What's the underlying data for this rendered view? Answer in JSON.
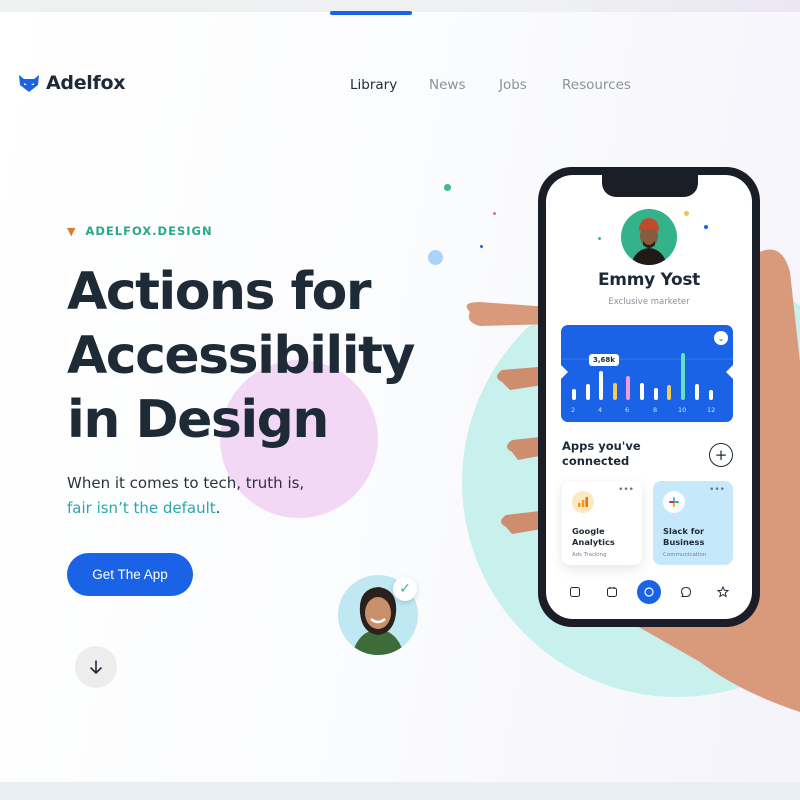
{
  "brand": {
    "name": "Adelfox"
  },
  "nav": {
    "items": [
      "Library",
      "News",
      "Jobs",
      "Resources"
    ],
    "active": "Library"
  },
  "hero": {
    "kicker": "ADELFOX.DESIGN",
    "headline": [
      "Actions for",
      "Accessibility",
      "in Design"
    ],
    "sub_line1": "When it comes to tech, truth is,",
    "sub_accent": "fair isn’t the default",
    "sub_end": ".",
    "cta_label": "Get The App"
  },
  "phone": {
    "profile": {
      "name": "Emmy Yost",
      "role": "Exclusive marketer"
    },
    "chart": {
      "tooltip": "3,68k",
      "x_labels": [
        "2",
        "4",
        "6",
        "8",
        "10",
        "12"
      ]
    },
    "apps": {
      "title": "Apps you've connected",
      "items": [
        {
          "name": "Google Analytics",
          "desc": "Ads Tracking"
        },
        {
          "name": "Slack for Business",
          "desc": "Communication"
        }
      ]
    }
  },
  "colors": {
    "brand_blue": "#1a63e6",
    "accent_teal": "#2aa6b0",
    "kicker_green": "#2ba889",
    "dark_text": "#1f2a37"
  },
  "icons": [
    "fox-logo-icon",
    "fox-emoji-icon",
    "arrow-down-icon",
    "check-icon",
    "chevron-down-icon",
    "plus-icon",
    "google-analytics-icon",
    "slack-icon",
    "home-icon",
    "calendar-icon",
    "search-icon",
    "chat-icon",
    "star-icon"
  ]
}
